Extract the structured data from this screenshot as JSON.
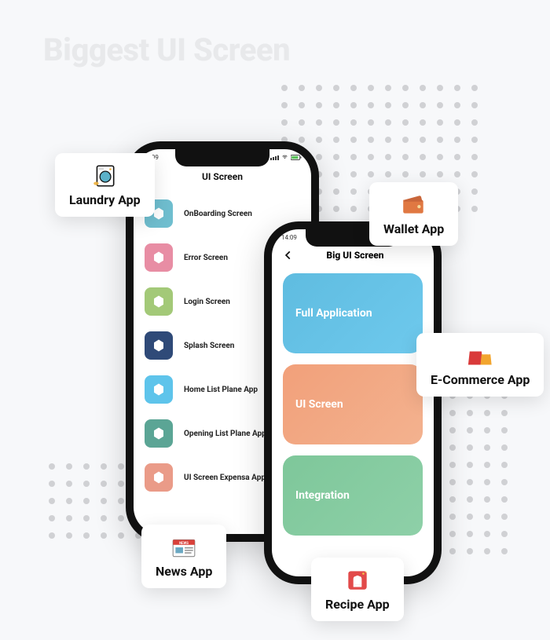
{
  "background_title": "Biggest UI Screen",
  "phone_back": {
    "status_time": "14:09",
    "title": "UI Screen",
    "items": [
      {
        "label": "OnBoarding Screen",
        "color": "#6fbecf"
      },
      {
        "label": "Error Screen",
        "color": "#e88da4"
      },
      {
        "label": "Login Screen",
        "color": "#a3c978"
      },
      {
        "label": "Splash Screen",
        "color": "#2f4a78"
      },
      {
        "label": "Home List Plane App",
        "color": "#5ec4eb"
      },
      {
        "label": "Opening List Plane App",
        "color": "#5ba595"
      },
      {
        "label": "UI Screen Expensa App",
        "color": "#ea9b88"
      }
    ]
  },
  "phone_front": {
    "status_time": "14:09",
    "title": "Big UI Screen",
    "cards": [
      {
        "label": "Full Application"
      },
      {
        "label": "UI Screen"
      },
      {
        "label": "Integration"
      }
    ]
  },
  "chips": {
    "laundry": "Laundry App",
    "wallet": "Wallet App",
    "ecommerce": "E-Commerce App",
    "news": "News App",
    "recipe": "Recipe App"
  }
}
